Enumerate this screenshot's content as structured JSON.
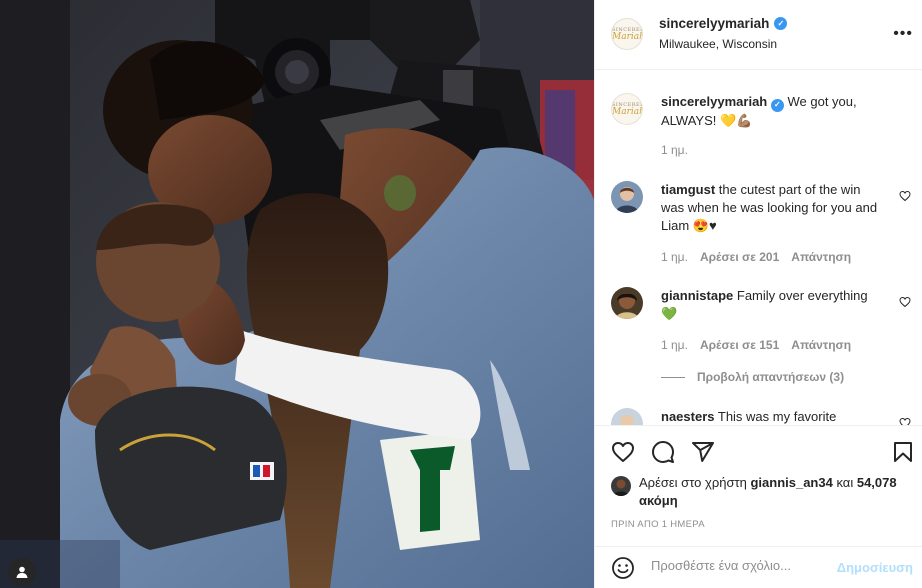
{
  "post": {
    "author": "sincerelyymariah",
    "location": "Milwaukee, Wisconsin",
    "avatar_small_text": "SINCERELY",
    "avatar_script_text": "Mariah"
  },
  "comments": [
    {
      "user": "sincerelyymariah",
      "verified": true,
      "text": "We got you, ALWAYS! 💛💪🏽",
      "time": "1 ημ."
    },
    {
      "user": "tiamgust",
      "text": "the cutest part of the win was when he was looking for you and Liam 😍♥",
      "time": "1 ημ.",
      "likes": "Αρέσει σε 201",
      "reply": "Απάντηση"
    },
    {
      "user": "giannistape",
      "text": "Family over everything 💚",
      "time": "1 ημ.",
      "likes": "Αρέσει σε 151",
      "reply": "Απάντηση",
      "view_replies": "Προβολή απαντήσεων (3)"
    },
    {
      "user": "naesters",
      "text": "This was my favorite"
    }
  ],
  "likes_line": {
    "prefix": "Αρέσει στο χρήστη",
    "user": "giannis_an34",
    "conj": "και",
    "count": "54,078 ακόμη"
  },
  "timestamp": "ΠΡΙΝ ΑΠΟ 1 ΗΜΕΡΑ",
  "add_comment": {
    "placeholder": "Προσθέστε ένα σχόλιο...",
    "post_label": "Δημοσίευση"
  },
  "colors": {
    "link_blue": "#3897f0",
    "post_disabled": "#b2dffc",
    "muted": "#8e8e8e",
    "jersey_green": "#00471b"
  },
  "icons": [
    "verified-badge-icon",
    "more-options-icon",
    "heart-icon",
    "comment-icon",
    "share-icon",
    "bookmark-icon",
    "emoji-icon",
    "user-tag-icon"
  ]
}
